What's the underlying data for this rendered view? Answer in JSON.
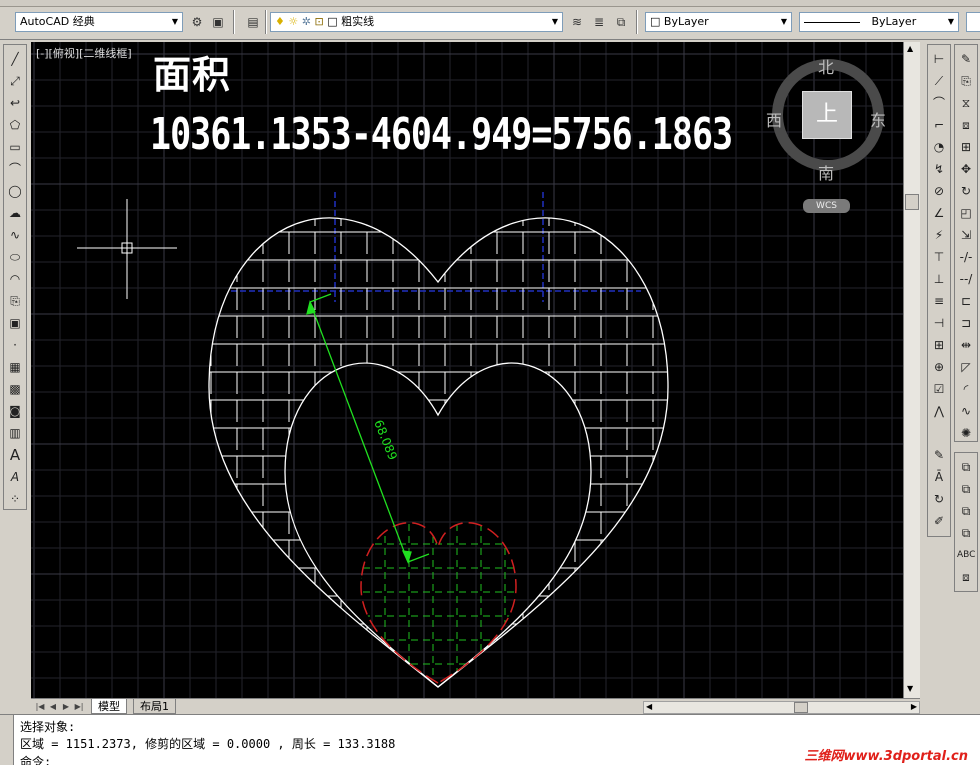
{
  "toolbar": {
    "workspace": "AutoCAD 经典",
    "layer": "粗实线",
    "color": "ByLayer",
    "linetype": "ByLayer"
  },
  "viewport": {
    "label": "[-][俯视][二维线框]"
  },
  "annotation": {
    "title": "面积",
    "formula": "10361.1353-4604.949=5756.1863"
  },
  "dimension": {
    "value": "68.089"
  },
  "viewcube": {
    "north": "北",
    "south": "南",
    "east": "东",
    "west": "西",
    "top": "上",
    "wcs": "WCS"
  },
  "tabs": {
    "model": "模型",
    "layout1": "布局1"
  },
  "command": {
    "line1": "选择对象:",
    "line2": "区域 = 1151.2373, 修剪的区域 = 0.0000 , 周长 = 133.3188",
    "line3": "命令:"
  },
  "watermark": "三维网www.3dportal.cn",
  "colors": {
    "canvas": "#000000",
    "outer_heart": "#ffffff",
    "small_heart": "#d02020",
    "hatch_small": "#20c020",
    "dimension": "#20e020",
    "axis": "#2030c0"
  }
}
